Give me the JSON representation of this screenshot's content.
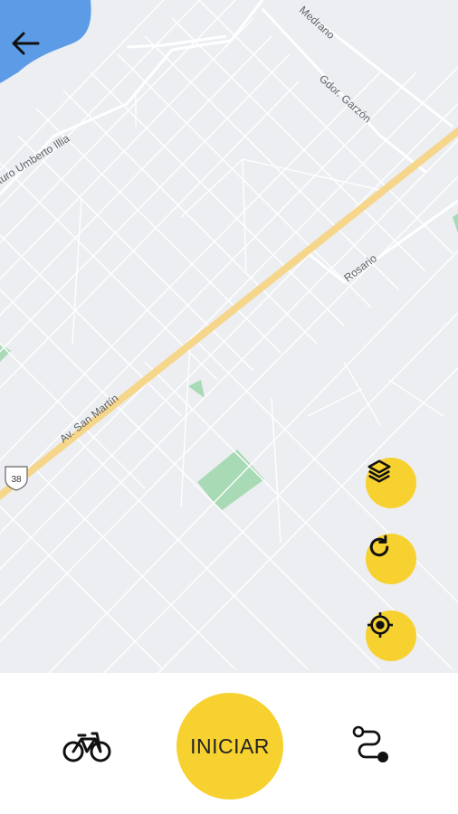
{
  "map": {
    "streets": {
      "medrano": "Medrano",
      "garzon": "Gdor. Garzón",
      "illia": "Arturo Umberto Illia",
      "rosario": "Rosario",
      "san_martin": "Av. San Martín",
      "route_shield": "38"
    }
  },
  "controls": {
    "back_icon": "arrow-left-icon",
    "layers_icon": "layers-icon",
    "refresh_icon": "refresh-icon",
    "locate_icon": "crosshair-icon"
  },
  "bottom_bar": {
    "start_label": "INICIAR",
    "bike_icon": "bicycle-icon",
    "route_icon": "route-icon"
  },
  "colors": {
    "accent": "#f7d130",
    "map_background": "#eceef1",
    "water": "#5c9ce6",
    "park": "#a8dab5",
    "main_road": "#f6d68b"
  }
}
